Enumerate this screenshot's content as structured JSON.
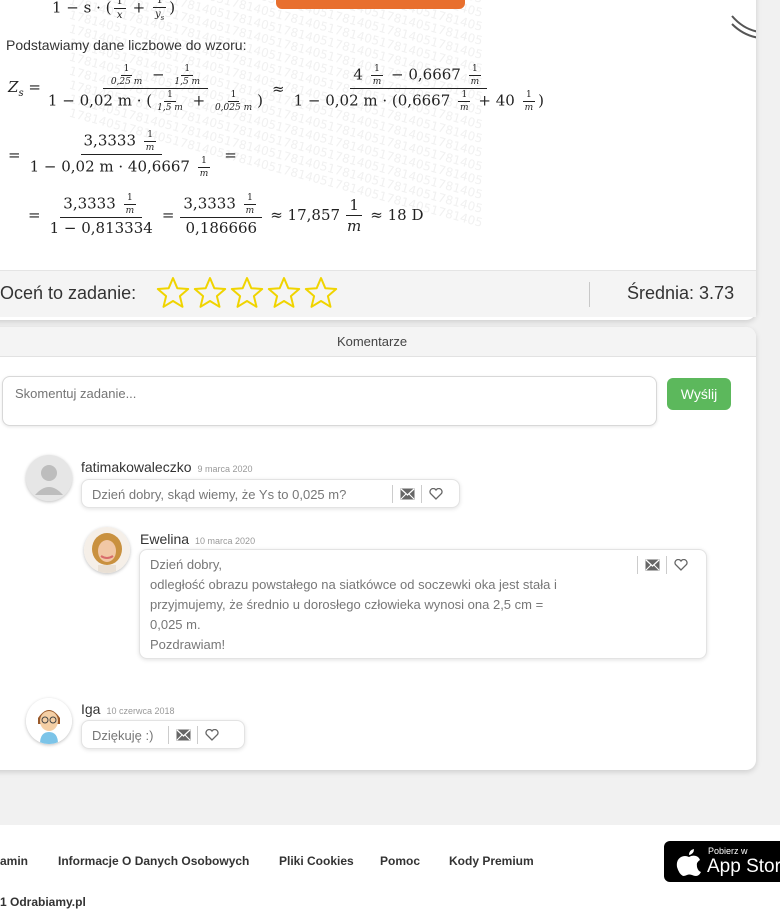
{
  "solution": {
    "intro": "Podstawiamy dane liczbowe do wzoru:",
    "watermark": "17814051781405178140517814051781405178140517814051781405",
    "formula_top": {
      "a": "1 − s ·",
      "b": "1",
      "c": "x",
      "d": "1",
      "e": "y",
      "f": "s"
    },
    "line1": {
      "zs": "Z",
      "zs_sub": "s",
      "n1a": "1",
      "n1b": "0,25 m",
      "n1c": "1",
      "n1d": "1,5 m",
      "d1a": "1 − 0,02 m ·",
      "d1b": "1",
      "d1c": "1,5 m",
      "d1d": "1",
      "d1e": "0,025 m",
      "n2": "4",
      "n2f": "1",
      "n2g": "m",
      "n2h": "− 0,6667",
      "n2i": "1",
      "n2j": "m",
      "d2a": "1 − 0,02 m · (0,6667",
      "d2b": "1",
      "d2c": "m",
      "d2d": "+ 40",
      "d2e": "1",
      "d2f": "m",
      "d2g": ")"
    },
    "line2": {
      "num": "3,3333",
      "nf": "1",
      "ng": "m",
      "den": "1 − 0,02 m · 40,6667",
      "df": "1",
      "dg": "m"
    },
    "line3": {
      "n1": "3,3333",
      "n1f": "1",
      "n1g": "m",
      "d1": "1 − 0,813334",
      "n2": "3,3333",
      "n2f": "1",
      "n2g": "m",
      "d2": "0,186666",
      "approx1": "≈ 17,857",
      "uf": "1",
      "ug": "m",
      "approx2": "≈ 18 D"
    }
  },
  "rating": {
    "label": "Oceń to zadanie:",
    "stars_total": 5,
    "stars_filled": 0,
    "average": "Średnia: 3.73",
    "star_color": "#f0d400"
  },
  "comments": {
    "header": "Komentarze",
    "input_placeholder": "Skomentuj zadanie...",
    "send_label": "Wyślij",
    "items": [
      {
        "author": "fatimakowaleczko",
        "date": "9 marca 2020",
        "text": "Dzień dobry, skąd wiemy, że Ys to 0,025 m?"
      },
      {
        "author": "Ewelina",
        "date": "10 marca 2020",
        "lines": [
          "Dzień dobry,",
          "odległość obrazu powstałego na siatkówce od soczewki oka jest stała i",
          "przyjmujemy, że średnio u dorosłego człowieka wynosi ona 2,5 cm =",
          "0,025 m.",
          "Pozdrawiam!"
        ]
      },
      {
        "author": "Iga",
        "date": "10 czerwca 2018",
        "text": "Dziękuję :)"
      }
    ]
  },
  "footer": {
    "links": [
      "amin",
      "Informacje O Danych Osobowych",
      "Pliki Cookies",
      "Pomoc",
      "Kody Premium"
    ],
    "copyright": "1 Odrabiamy.pl",
    "appstore_small": "Pobierz w",
    "appstore_big": "App Store"
  }
}
